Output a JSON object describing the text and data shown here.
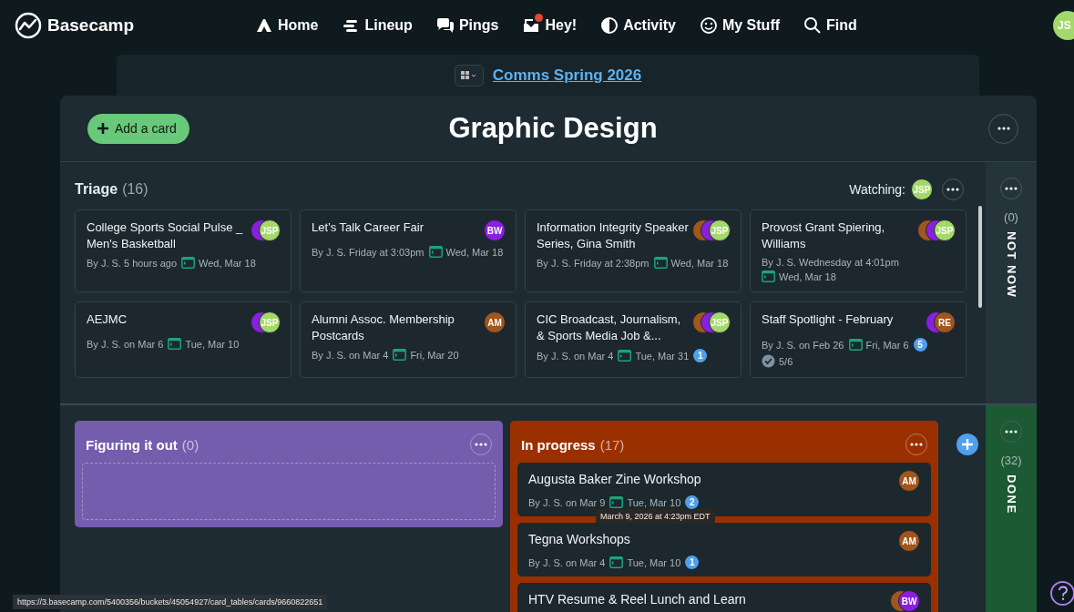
{
  "nav": {
    "logo": "Basecamp",
    "items": [
      {
        "label": "Home",
        "badge": false
      },
      {
        "label": "Lineup",
        "badge": false
      },
      {
        "label": "Pings",
        "badge": false
      },
      {
        "label": "Hey!",
        "badge": true
      },
      {
        "label": "Activity",
        "badge": false
      },
      {
        "label": "My Stuff",
        "badge": false
      },
      {
        "label": "Find",
        "badge": false
      }
    ],
    "avatar": {
      "initials": "JS",
      "color": "#a3d96a"
    }
  },
  "project": {
    "title": "Comms Spring 2026"
  },
  "board": {
    "title": "Graphic Design",
    "add_button": "Add a card"
  },
  "triage": {
    "name": "Triage",
    "count": "(16)",
    "watching_label": "Watching:",
    "watchers": [
      {
        "initials": "JSP",
        "color": "#a3d96a"
      }
    ],
    "cards": [
      {
        "title": "College Sports Social Pulse _ Men's Basketball",
        "meta": "By J. S. 5 hours ago",
        "due": "Wed, Mar 18",
        "avatars": [
          {
            "color": "#8a1fe0"
          },
          {
            "initials": "JSP",
            "color": "#a3d96a"
          }
        ]
      },
      {
        "title": "Let’s Talk Career Fair",
        "meta": "By J. S. Friday at 3:03pm",
        "due": "Wed, Mar 18",
        "avatars": [
          {
            "initials": "BW",
            "color": "#8a1fe0"
          }
        ]
      },
      {
        "title": "Information Integrity Speaker Series, Gina Smith",
        "meta": "By J. S. Friday at 2:38pm",
        "due": "Wed, Mar 18",
        "avatars": [
          {
            "color": "#a0561d"
          },
          {
            "color": "#8a1fe0"
          },
          {
            "initials": "JSP",
            "color": "#a3d96a"
          }
        ]
      },
      {
        "title": "Provost Grant Spiering, Williams",
        "meta": "By J. S. Wednesday at 4:01pm",
        "due": "Wed, Mar 18",
        "avatars": [
          {
            "color": "#a0561d"
          },
          {
            "color": "#8a1fe0"
          },
          {
            "initials": "JSP",
            "color": "#a3d96a"
          }
        ]
      },
      {
        "title": "AEJMC",
        "meta": "By J. S. on Mar 6",
        "due": "Tue, Mar 10",
        "avatars": [
          {
            "color": "#8a1fe0"
          },
          {
            "initials": "JSP",
            "color": "#a3d96a"
          }
        ]
      },
      {
        "title": "Alumni Assoc. Membership Postcards",
        "meta": "By J. S. on Mar 4",
        "due": "Fri, Mar 20",
        "avatars": [
          {
            "initials": "AM",
            "color": "#a0561d"
          }
        ]
      },
      {
        "title": "CIC Broadcast, Journalism, & Sports Media Job &...",
        "meta": "By J. S. on Mar 4",
        "due": "Tue, Mar 31",
        "comments": "1",
        "avatars": [
          {
            "color": "#a0561d"
          },
          {
            "color": "#8a1fe0"
          },
          {
            "initials": "JSP",
            "color": "#a3d96a"
          }
        ]
      },
      {
        "title": "Staff Spotlight - February",
        "meta": "By J. S. on Feb 26",
        "due": "Fri, Mar 6",
        "comments": "5",
        "checklist": "5/6",
        "avatars": [
          {
            "color": "#8a1fe0"
          },
          {
            "initials": "RE",
            "color": "#a0561d"
          }
        ]
      }
    ]
  },
  "not_now": {
    "count": "(0)",
    "label": "NOT NOW"
  },
  "columns": [
    {
      "name": "Figuring it out",
      "count": "(0)",
      "color": "#745dad"
    },
    {
      "name": "In progress",
      "count": "(17)",
      "color": "#9a3000",
      "cards": [
        {
          "title": "Augusta Baker Zine Workshop",
          "meta": "By J. S. on Mar 9",
          "due": "Tue, Mar 10",
          "comments": "2",
          "tooltip": "March 9, 2026 at 4:23pm EDT",
          "avatars": [
            {
              "initials": "AM",
              "color": "#a0561d"
            }
          ]
        },
        {
          "title": "Tegna Workshops",
          "meta": "By J. S. on Mar 4",
          "due": "Tue, Mar 10",
          "comments": "1",
          "avatars": [
            {
              "initials": "AM",
              "color": "#a0561d"
            }
          ]
        },
        {
          "title": "HTV Resume & Reel Lunch and Learn",
          "avatars": [
            {
              "color": "#a0561d"
            },
            {
              "initials": "BW",
              "color": "#8a1fe0"
            }
          ]
        }
      ]
    }
  ],
  "done": {
    "count": "(32)",
    "label": "DONE"
  },
  "status_url": "https://3.basecamp.com/5400356/buckets/45054927/card_tables/cards/9660822651"
}
